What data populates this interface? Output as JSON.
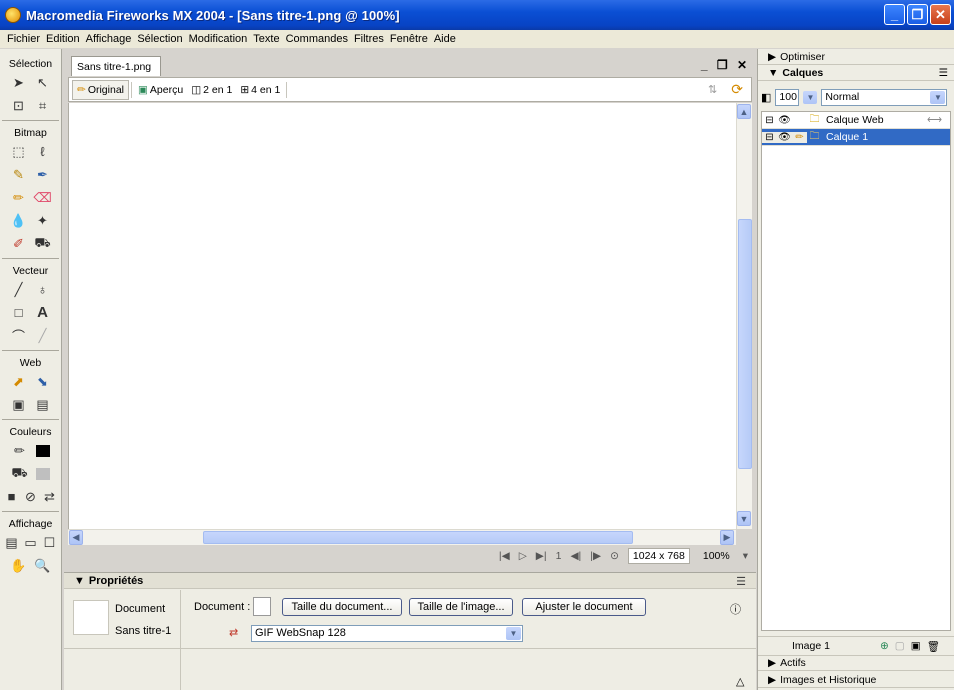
{
  "window": {
    "title": "Macromedia Fireworks MX 2004 - [Sans titre-1.png @ 100%]"
  },
  "menu": [
    "Fichier",
    "Edition",
    "Affichage",
    "Sélection",
    "Modification",
    "Texte",
    "Commandes",
    "Filtres",
    "Fenêtre",
    "Aide"
  ],
  "toolbox": {
    "sections": [
      "Sélection",
      "Bitmap",
      "Vecteur",
      "Web",
      "Couleurs",
      "Affichage"
    ]
  },
  "document": {
    "tab": "Sans titre-1.png",
    "view_tabs": [
      "Original",
      "Aperçu",
      "2 en 1",
      "4 en 1"
    ],
    "status": {
      "frame": "1",
      "size": "1024 x 768",
      "zoom": "100%"
    }
  },
  "properties": {
    "title": "Propriétés",
    "type": "Document",
    "name": "Sans titre-1",
    "document_label": "Document :",
    "buttons": [
      "Taille du document...",
      "Taille de l'image...",
      "Ajuster le document"
    ],
    "format": "GIF WebSnap 128"
  },
  "right_panel": {
    "optimiser": "Optimiser",
    "calques": "Calques",
    "opacity": "100",
    "blend": "Normal",
    "layers": [
      {
        "name": "Calque Web",
        "selected": false
      },
      {
        "name": "Calque 1",
        "selected": true
      }
    ],
    "frame_label": "Image 1",
    "actifs": "Actifs",
    "images_historique": "Images et Historique"
  },
  "colors": {
    "titlebar": "#0a4fd4",
    "selection": "#316ac5",
    "panel_bg": "#eeede4"
  }
}
